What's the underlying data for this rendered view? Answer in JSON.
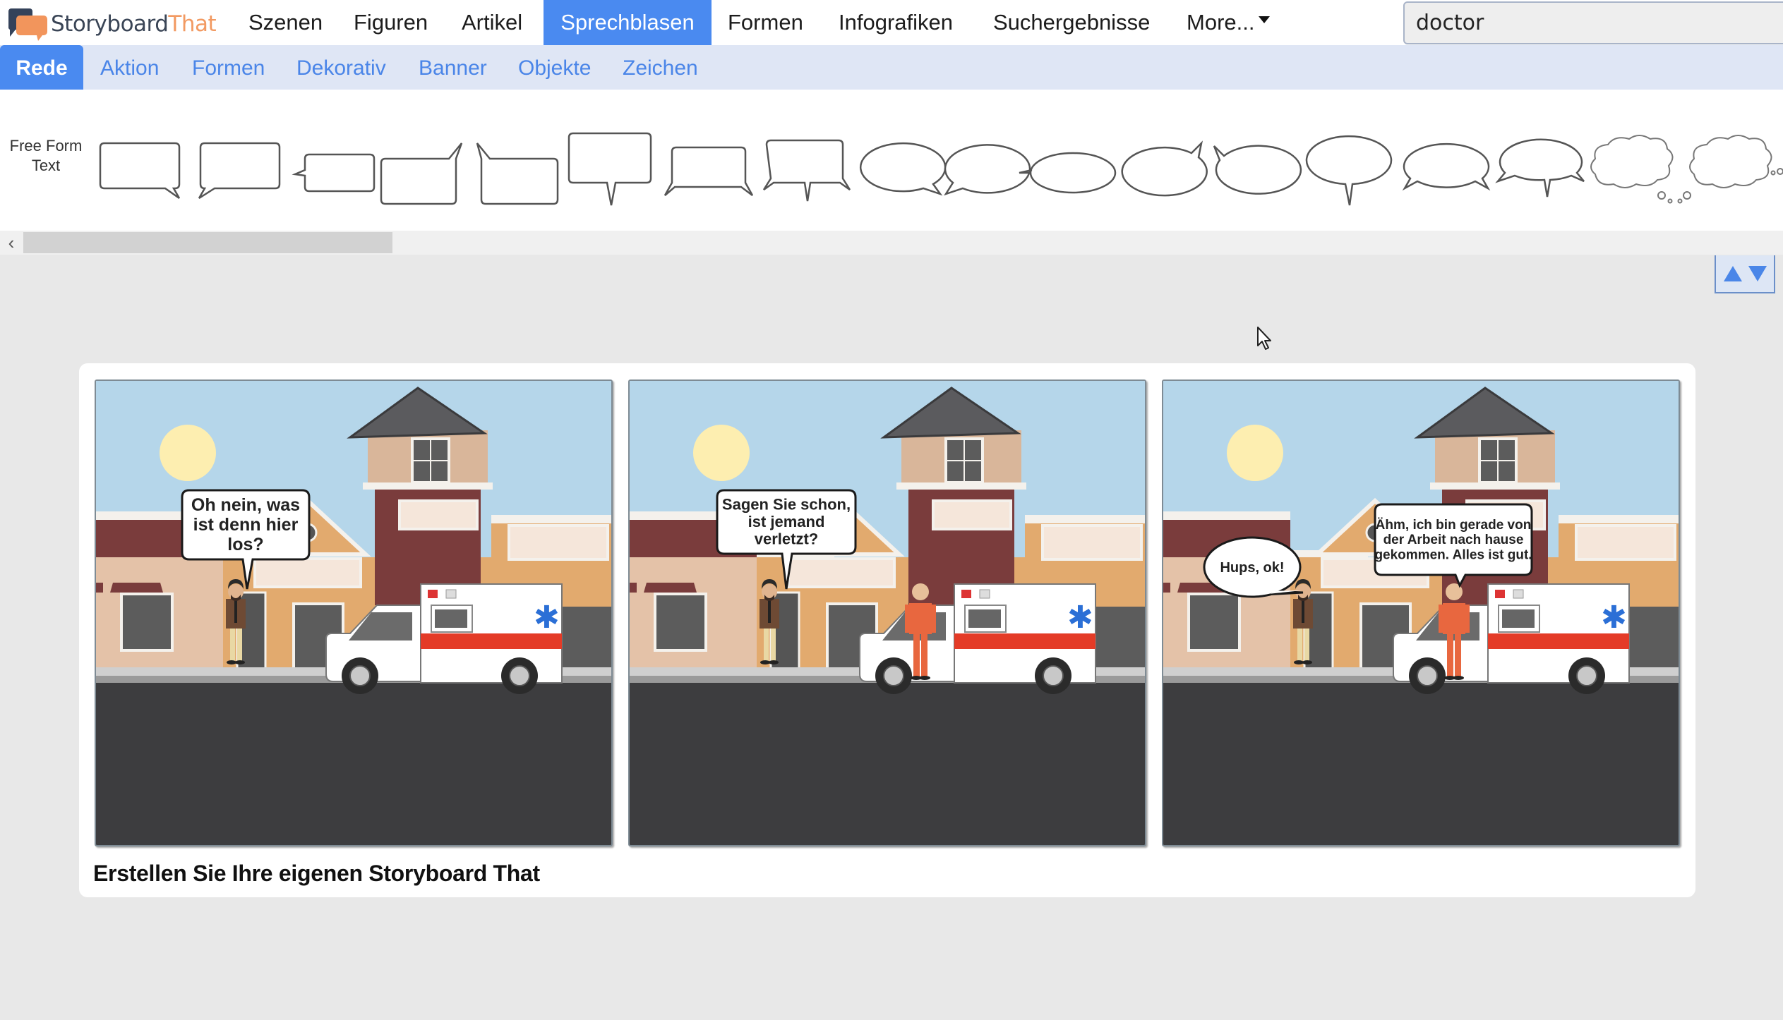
{
  "app": {
    "logo_part1": "Storyboard",
    "logo_part2": "That",
    "brand_colors": {
      "dark": "#3a4556",
      "orange": "#f29a62",
      "accent": "#4a8af0"
    }
  },
  "topnav": {
    "items": [
      {
        "label": "Szenen",
        "active": false
      },
      {
        "label": "Figuren",
        "active": false
      },
      {
        "label": "Artikel",
        "active": false
      },
      {
        "label": "Sprechblasen",
        "active": true
      },
      {
        "label": "Formen",
        "active": false
      },
      {
        "label": "Infografiken",
        "active": false
      },
      {
        "label": "Suchergebnisse",
        "active": false
      },
      {
        "label": "More...",
        "active": false,
        "dropdown": true
      }
    ],
    "search_value": "doctor"
  },
  "subnav": {
    "items": [
      {
        "label": "Rede",
        "active": true
      },
      {
        "label": "Aktion",
        "active": false
      },
      {
        "label": "Formen",
        "active": false
      },
      {
        "label": "Dekorativ",
        "active": false
      },
      {
        "label": "Banner",
        "active": false
      },
      {
        "label": "Objekte",
        "active": false
      },
      {
        "label": "Zeichen",
        "active": false
      }
    ]
  },
  "bubblebar": {
    "free_form_line1": "Free Form",
    "free_form_line2": "Text",
    "bubble_types": [
      "rect-tail-bottom-right",
      "rect-tail-bottom-left",
      "rect-tail-left",
      "rect-tail-top-right",
      "rect-tail-top-left",
      "rect-tail-bottom-center",
      "rect-tails-both-sides",
      "rect-tails-three",
      "oval-tail-bottom-right",
      "oval-tail-bottom-left",
      "oval-tail-left",
      "oval-tail-top-right",
      "oval-tail-top-left",
      "oval-tail-bottom-center",
      "oval-tails-both-sides",
      "oval-tails-three",
      "thought-cloud-right",
      "thought-cloud-left"
    ]
  },
  "storyboard": {
    "panels": [
      {
        "bubbles": [
          {
            "shape": "rect",
            "lines": [
              "Oh nein, was",
              "ist denn hier",
              "los?"
            ]
          }
        ],
        "characters": [
          "man-in-jacket"
        ]
      },
      {
        "bubbles": [
          {
            "shape": "rect",
            "lines": [
              "Sagen Sie schon,",
              "ist jemand",
              "verletzt?"
            ]
          }
        ],
        "characters": [
          "man-in-jacket",
          "man-in-orange-scrubs"
        ]
      },
      {
        "bubbles": [
          {
            "shape": "oval",
            "lines": [
              "Hups, ok!"
            ]
          },
          {
            "shape": "rect",
            "lines": [
              "Ähm, ich bin gerade von",
              "der Arbeit nach hause",
              "gekommen. Alles ist gut."
            ]
          }
        ],
        "characters": [
          "man-in-jacket",
          "man-in-orange-scrubs"
        ]
      }
    ],
    "caption": "Erstellen Sie Ihre eigenen Storyboard That"
  }
}
